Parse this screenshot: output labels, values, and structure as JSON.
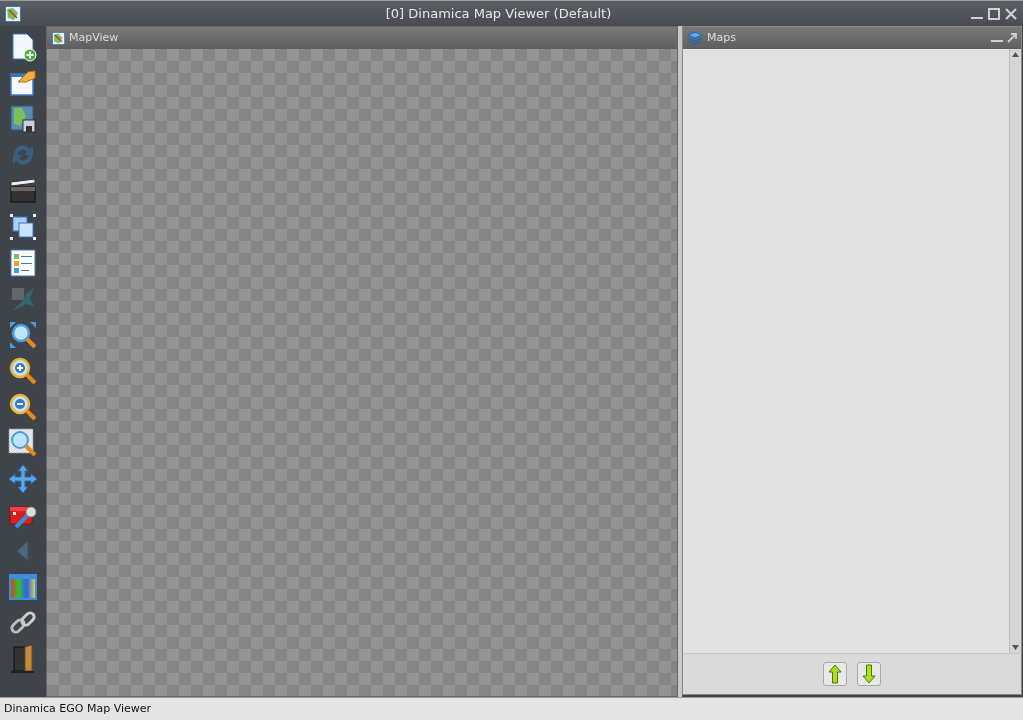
{
  "window": {
    "title": "[0] Dinamica Map Viewer (Default)"
  },
  "toolbar": [
    {
      "kind": "new",
      "disabled": false
    },
    {
      "kind": "open",
      "disabled": false
    },
    {
      "kind": "save",
      "disabled": false
    },
    {
      "kind": "refresh",
      "disabled": true
    },
    {
      "kind": "clapper",
      "disabled": false
    },
    {
      "kind": "select",
      "disabled": false
    },
    {
      "kind": "legend",
      "disabled": false
    },
    {
      "kind": "bird",
      "disabled": true
    },
    {
      "kind": "zoomfit",
      "disabled": false
    },
    {
      "kind": "zoomin",
      "disabled": false
    },
    {
      "kind": "zoomout",
      "disabled": false
    },
    {
      "kind": "zoombox",
      "disabled": false
    },
    {
      "kind": "pan",
      "disabled": false
    },
    {
      "kind": "toolbox",
      "disabled": false
    },
    {
      "kind": "back",
      "disabled": true
    },
    {
      "kind": "palette",
      "disabled": false
    },
    {
      "kind": "link",
      "disabled": false
    },
    {
      "kind": "door",
      "disabled": false
    }
  ],
  "map_view": {
    "title": "MapView"
  },
  "maps_panel": {
    "title": "Maps"
  },
  "status_bar": "Dinamica EGO Map Viewer"
}
